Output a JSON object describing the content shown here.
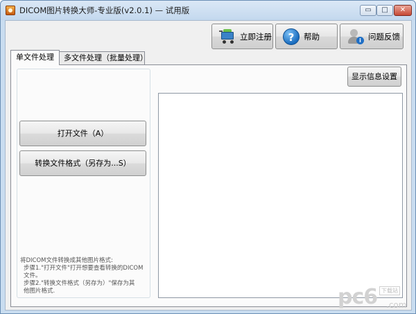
{
  "window": {
    "title": "DICOM图片转换大师-专业版(v2.0.1) — 试用版",
    "buttons": {
      "minimize": "▭",
      "maximize": "□",
      "close": "✕"
    }
  },
  "toolbar": {
    "register_label": "立即注册",
    "help_label": "帮助",
    "feedback_label": "问题反馈",
    "icons": {
      "register": "shopping-cart-icon",
      "help": "help-icon",
      "feedback": "user-info-icon"
    }
  },
  "tabs": [
    {
      "label": "单文件处理",
      "active": true
    },
    {
      "label": "多文件处理（批量处理）",
      "active": false
    }
  ],
  "single": {
    "open_button": "打开文件（A）",
    "convert_button": "转换文件格式（另存为...S）",
    "display_settings_button": "显示信息设置",
    "description": {
      "line1": "将DICOM文件转换成其他图片格式:",
      "line2": "步骤1.\"打开文件\"打开想要查看转换的DICOM",
      "line3": "文件。",
      "line4": "步骤2.\"转换文件格式（另存为）\"保存为其",
      "line5": "他图片格式."
    }
  },
  "watermark": {
    "brand": "pc6",
    "tag": "下载站",
    "domain": ".com"
  },
  "colors": {
    "titlebar": "#c9ddf0",
    "client": "#f0f0f0",
    "close": "#c64a36"
  }
}
